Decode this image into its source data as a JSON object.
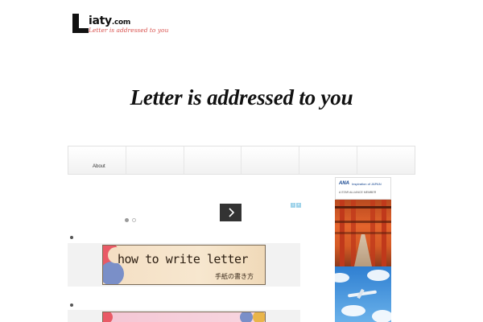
{
  "header": {
    "logo_name": "iaty",
    "logo_dotcom": ".com",
    "logo_tagline": "Letter is addressed to you"
  },
  "site": {
    "title": "Letter is addressed to you"
  },
  "nav": {
    "items": [
      "About",
      "",
      "",
      "",
      "",
      ""
    ]
  },
  "slider": {
    "dots": 2,
    "active_dot": 0
  },
  "posts": [
    {
      "banner_title": "how to write letter",
      "banner_subtitle": "手紙の書き方"
    },
    {
      "banner_title": "",
      "banner_subtitle": ""
    }
  ],
  "ad": {
    "brand": "ANA",
    "tagline": "Inspiration of JAPAN",
    "alliance": "A STAR ALLIANCE MEMBER"
  },
  "colors": {
    "accent_red": "#d9534f",
    "nav_bg": "#f1f1f1",
    "ana_blue": "#13448f"
  },
  "icons": {
    "next": "chevron-right-icon",
    "ad_choices": "ad-choices-icon"
  }
}
